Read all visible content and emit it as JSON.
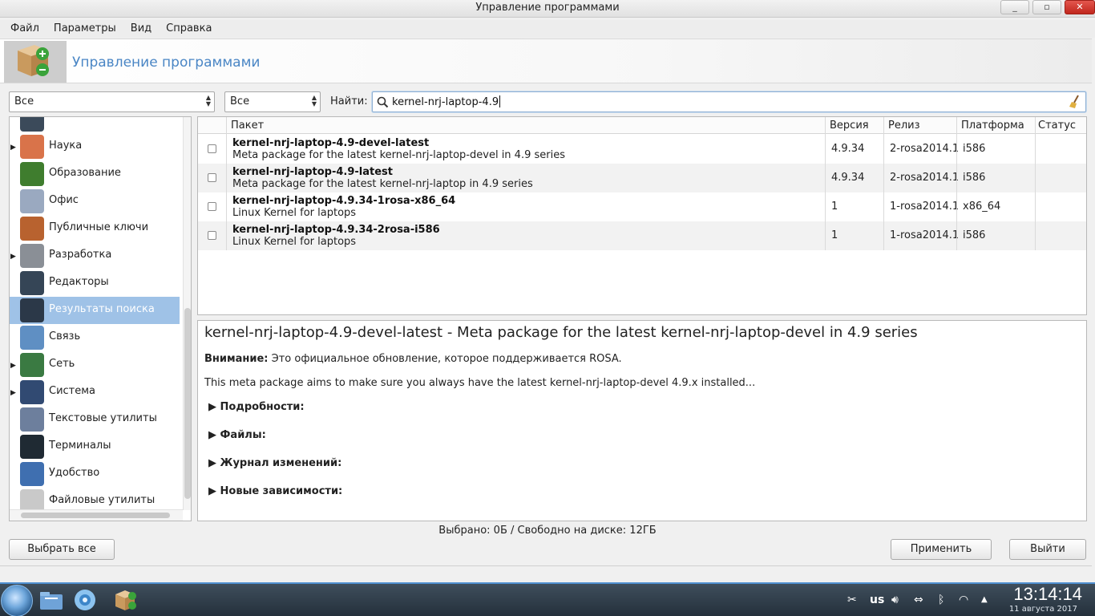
{
  "window": {
    "title": "Управление программами",
    "minimize_glyph": "_",
    "maximize_glyph": "▫",
    "close_glyph": "✕"
  },
  "menu": [
    "Файл",
    "Параметры",
    "Вид",
    "Справка"
  ],
  "banner": {
    "title": "Управление программами",
    "icon": "package-manager-icon"
  },
  "filters": {
    "category_filter": "Все",
    "type_filter": "Все",
    "find_label": "Найти:",
    "search_value": "kernel-nrj-laptop-4.9"
  },
  "categories": [
    {
      "label": "",
      "icon": "monitor-icon",
      "expandable": false,
      "selected": false,
      "color": "#3b4a5a"
    },
    {
      "label": "Наука",
      "icon": "atom-icon",
      "expandable": true,
      "selected": false,
      "color": "#d9734a"
    },
    {
      "label": "Образование",
      "icon": "chalkboard-icon",
      "expandable": false,
      "selected": false,
      "color": "#3f7d2e"
    },
    {
      "label": "Офис",
      "icon": "office-icon",
      "expandable": false,
      "selected": false,
      "color": "#9aa9c0"
    },
    {
      "label": "Публичные ключи",
      "icon": "keys-icon",
      "expandable": false,
      "selected": false,
      "color": "#b8622f"
    },
    {
      "label": "Разработка",
      "icon": "tools-icon",
      "expandable": true,
      "selected": false,
      "color": "#8a8f96"
    },
    {
      "label": "Редакторы",
      "icon": "editor-monitor-icon",
      "expandable": false,
      "selected": false,
      "color": "#354556"
    },
    {
      "label": "Результаты поиска",
      "icon": "star-icon",
      "expandable": false,
      "selected": true,
      "color": "#2b3848"
    },
    {
      "label": "Связь",
      "icon": "phone-icon",
      "expandable": false,
      "selected": false,
      "color": "#5f8fc3"
    },
    {
      "label": "Сеть",
      "icon": "globe-icon",
      "expandable": true,
      "selected": false,
      "color": "#3a7a42"
    },
    {
      "label": "Система",
      "icon": "system-icon",
      "expandable": true,
      "selected": false,
      "color": "#314a72"
    },
    {
      "label": "Текстовые утилиты",
      "icon": "pen-icon",
      "expandable": false,
      "selected": false,
      "color": "#6d7f9d"
    },
    {
      "label": "Терминалы",
      "icon": "terminal-icon",
      "expandable": false,
      "selected": false,
      "color": "#1f2a33"
    },
    {
      "label": "Удобство",
      "icon": "accessibility-icon",
      "expandable": false,
      "selected": false,
      "color": "#3f6fb0"
    },
    {
      "label": "Файловые утилиты",
      "icon": "file-icon",
      "expandable": false,
      "selected": false,
      "color": "#c9c9c9"
    }
  ],
  "table": {
    "columns": [
      "Пакет",
      "Версия",
      "Релиз",
      "Платформа",
      "Статус"
    ],
    "rows": [
      {
        "name": "kernel-nrj-laptop-4.9-devel-latest",
        "desc": "Meta package for the latest kernel-nrj-laptop-devel in 4.9 series",
        "version": "4.9.34",
        "release": "2-rosa2014.1",
        "platform": "i586",
        "status": ""
      },
      {
        "name": "kernel-nrj-laptop-4.9-latest",
        "desc": "Meta package for the latest kernel-nrj-laptop in 4.9 series",
        "version": "4.9.34",
        "release": "2-rosa2014.1",
        "platform": "i586",
        "status": ""
      },
      {
        "name": "kernel-nrj-laptop-4.9.34-1rosa-x86_64",
        "desc": "Linux Kernel for laptops",
        "version": "1",
        "release": "1-rosa2014.1",
        "platform": "x86_64",
        "status": ""
      },
      {
        "name": "kernel-nrj-laptop-4.9.34-2rosa-i586",
        "desc": "Linux Kernel for laptops",
        "version": "1",
        "release": "1-rosa2014.1",
        "platform": "i586",
        "status": ""
      }
    ]
  },
  "details": {
    "title": "kernel-nrj-laptop-4.9-devel-latest - Meta package for the latest kernel-nrj-laptop-devel in 4.9 series",
    "warning_label": "Внимание:",
    "warning_text": " Это официальное обновление, которое поддерживается ROSA.",
    "body": "This meta package aims to make sure you always have the latest kernel-nrj-laptop-devel 4.9.x installed...",
    "sections": [
      "Подробности:",
      "Файлы:",
      "Журнал изменений:",
      "Новые зависимости:"
    ]
  },
  "status": "Выбрано: 0Б / Свободно на диске: 12ГБ",
  "buttons": {
    "select_all": "Выбрать все",
    "apply": "Применить",
    "quit": "Выйти"
  },
  "taskbar": {
    "apps": [
      {
        "icon": "file-manager-icon",
        "color": "#6fa3d8"
      },
      {
        "icon": "browser-icon",
        "color": "#8cc3ef"
      },
      {
        "icon": "package-manager-icon",
        "color": "#c9a06a"
      }
    ],
    "keyboard_layout": "us",
    "time": "13:14:14",
    "date": "11 августа 2017"
  }
}
